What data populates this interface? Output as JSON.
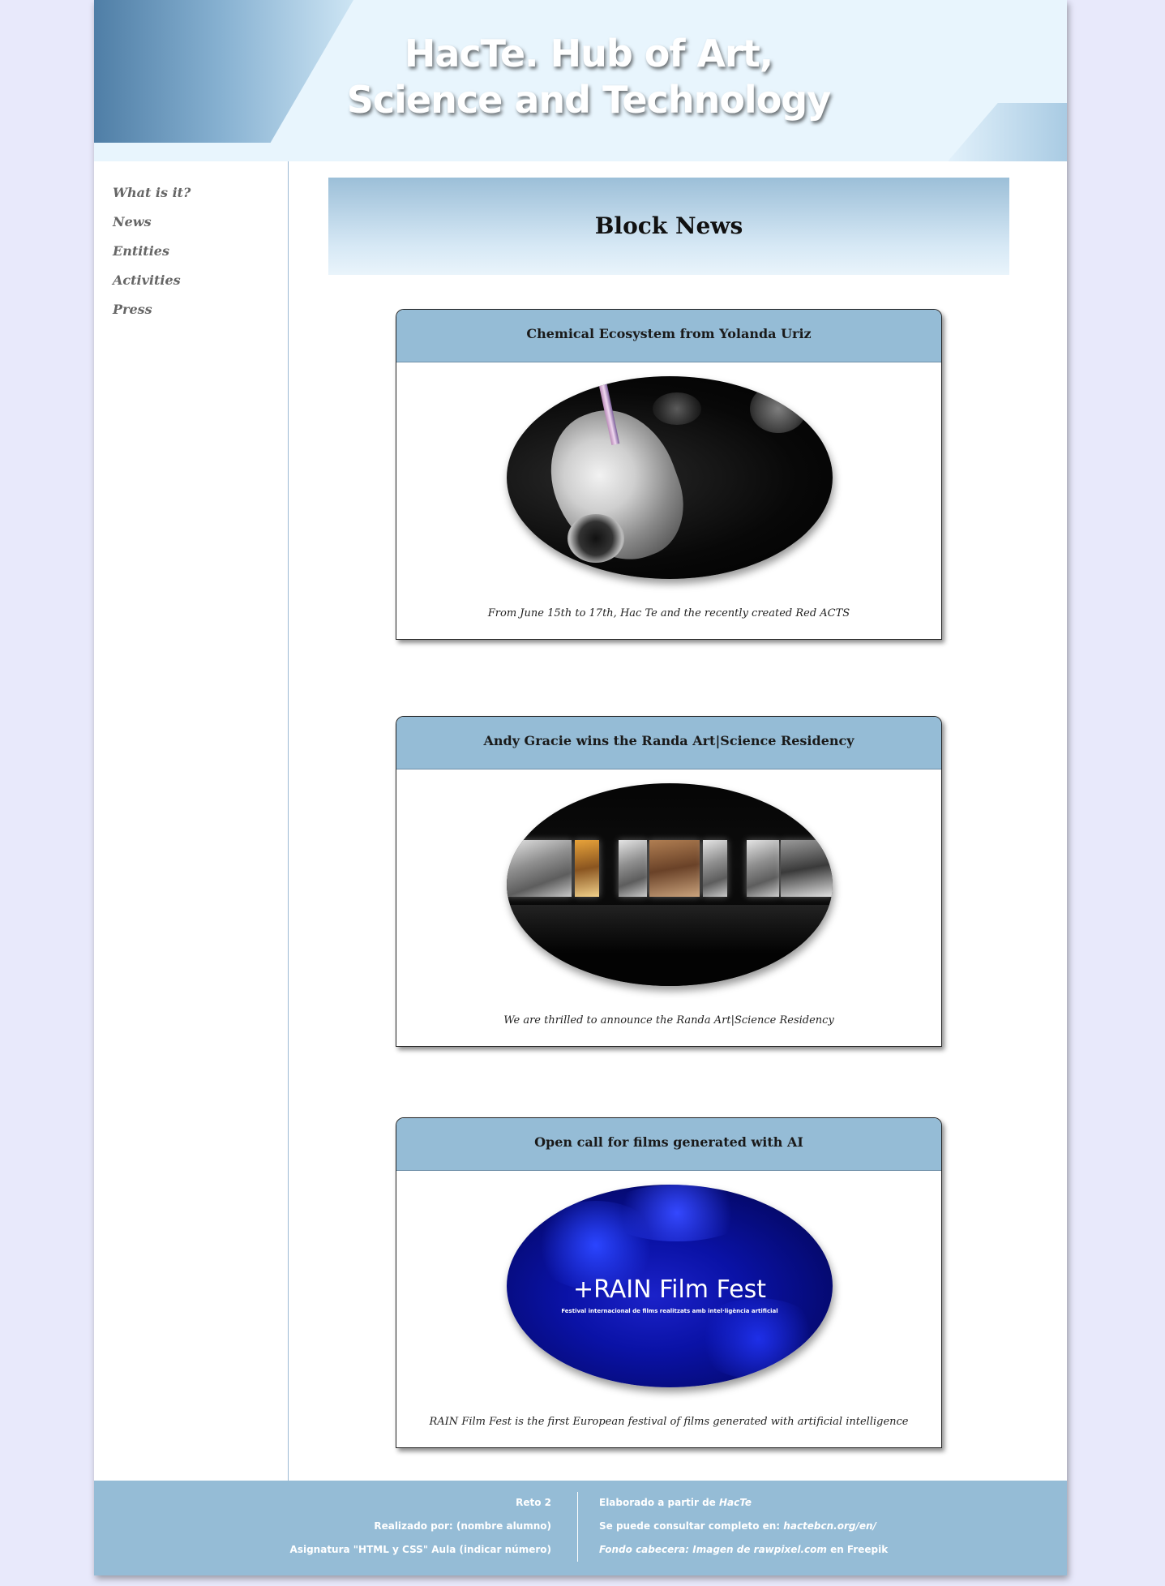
{
  "header": {
    "title": "HacTe. Hub of Art,\nScience and Technology"
  },
  "nav": {
    "items": [
      "What is it?",
      "News",
      "Entities",
      "Activities",
      "Press"
    ]
  },
  "main": {
    "block_title": "Block News",
    "cards": [
      {
        "title": "Chemical Ecosystem from Yolanda Uriz",
        "caption": "From June 15th to 17th, Hac Te and the recently created Red ACTS"
      },
      {
        "title": "Andy Gracie wins the Randa Art|Science Residency",
        "caption": "We are thrilled to announce the Randa Art|Science Residency"
      },
      {
        "title": "Open call for films generated with AI",
        "caption": "RAIN Film Fest is the first European festival of films generated with artificial intelligence",
        "image_text": "+RAIN Film Fest",
        "image_subtext": "Festival internacional de films realitzats amb intel·ligència artificial"
      }
    ]
  },
  "footer": {
    "left": [
      "Reto 2",
      "Realizado por: (nombre alumno)",
      "Asignatura \"HTML y CSS\" Aula (indicar número)"
    ],
    "right_1_prefix": "Elaborado a partir de ",
    "right_1_em": "HacTe",
    "right_2_prefix": "Se puede consultar completo en: ",
    "right_2_em": "hactebcn.org/en/",
    "right_3_em": "Fondo cabecera: Imagen de rawpixel.com",
    "right_3_suffix": " en Freepik"
  },
  "colors": {
    "background": "#e8e9fb",
    "header_bg": "#e8f5fd",
    "accent": "#95bcd6",
    "nav_text": "#666666"
  }
}
